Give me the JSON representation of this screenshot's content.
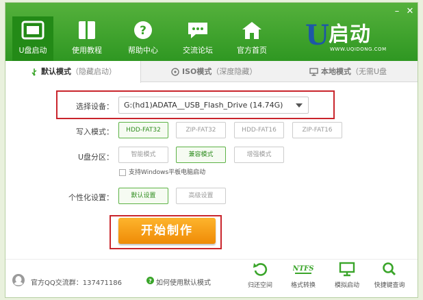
{
  "nav": {
    "items": [
      {
        "label": "U盘启动"
      },
      {
        "label": "使用教程"
      },
      {
        "label": "帮助中心"
      },
      {
        "label": "交流论坛"
      },
      {
        "label": "官方首页"
      }
    ],
    "active_index": 0
  },
  "window": {
    "minimize": "–",
    "close": "✕"
  },
  "brand": {
    "letter": "U",
    "name": "启动",
    "url": "WWW.UQIDONG.COM",
    "logo_color": "#1d57a7"
  },
  "tabs": [
    {
      "main": "默认模式",
      "sub": "（隐藏启动）",
      "icon": "usb-icon"
    },
    {
      "main": "ISO模式",
      "sub": "（深度隐藏）",
      "icon": "disc-icon"
    },
    {
      "main": "本地模式",
      "sub": "（无需U盘",
      "icon": "monitor-icon"
    }
  ],
  "device": {
    "label": "选择设备：",
    "value": "G:(hd1)ADATA__USB_Flash_Drive (14.74G)"
  },
  "write_mode": {
    "label": "写入模式：",
    "options": [
      "HDD-FAT32",
      "ZIP-FAT32",
      "HDD-FAT16",
      "ZIP-FAT16"
    ],
    "selected": 0
  },
  "partition": {
    "label": "U盘分区：",
    "options": [
      "智能模式",
      "兼容模式",
      "增强模式"
    ],
    "selected": 1
  },
  "tablet_support": {
    "label": "支持Windows平板电脑启动",
    "checked": false
  },
  "personalize": {
    "label": "个性化设置：",
    "options": [
      "默认设置",
      "高级设置"
    ],
    "selected": 0
  },
  "start_button": {
    "label": "开始制作"
  },
  "footer": {
    "qq_group": "官方QQ交流群：137471186",
    "help_link": "如何使用默认模式",
    "tools": [
      {
        "label": "归还空间",
        "icon": "restore-icon"
      },
      {
        "label": "格式转换",
        "icon": "ntfs-icon",
        "icon_text": "NTFS"
      },
      {
        "label": "模拟启动",
        "icon": "monitor-icon"
      },
      {
        "label": "快捷键查询",
        "icon": "search-icon"
      }
    ]
  },
  "colors": {
    "header_green": "#3aa52a",
    "accent_green": "#5cb245",
    "start_orange": "#f39b12",
    "highlight_red": "#c9242b"
  }
}
